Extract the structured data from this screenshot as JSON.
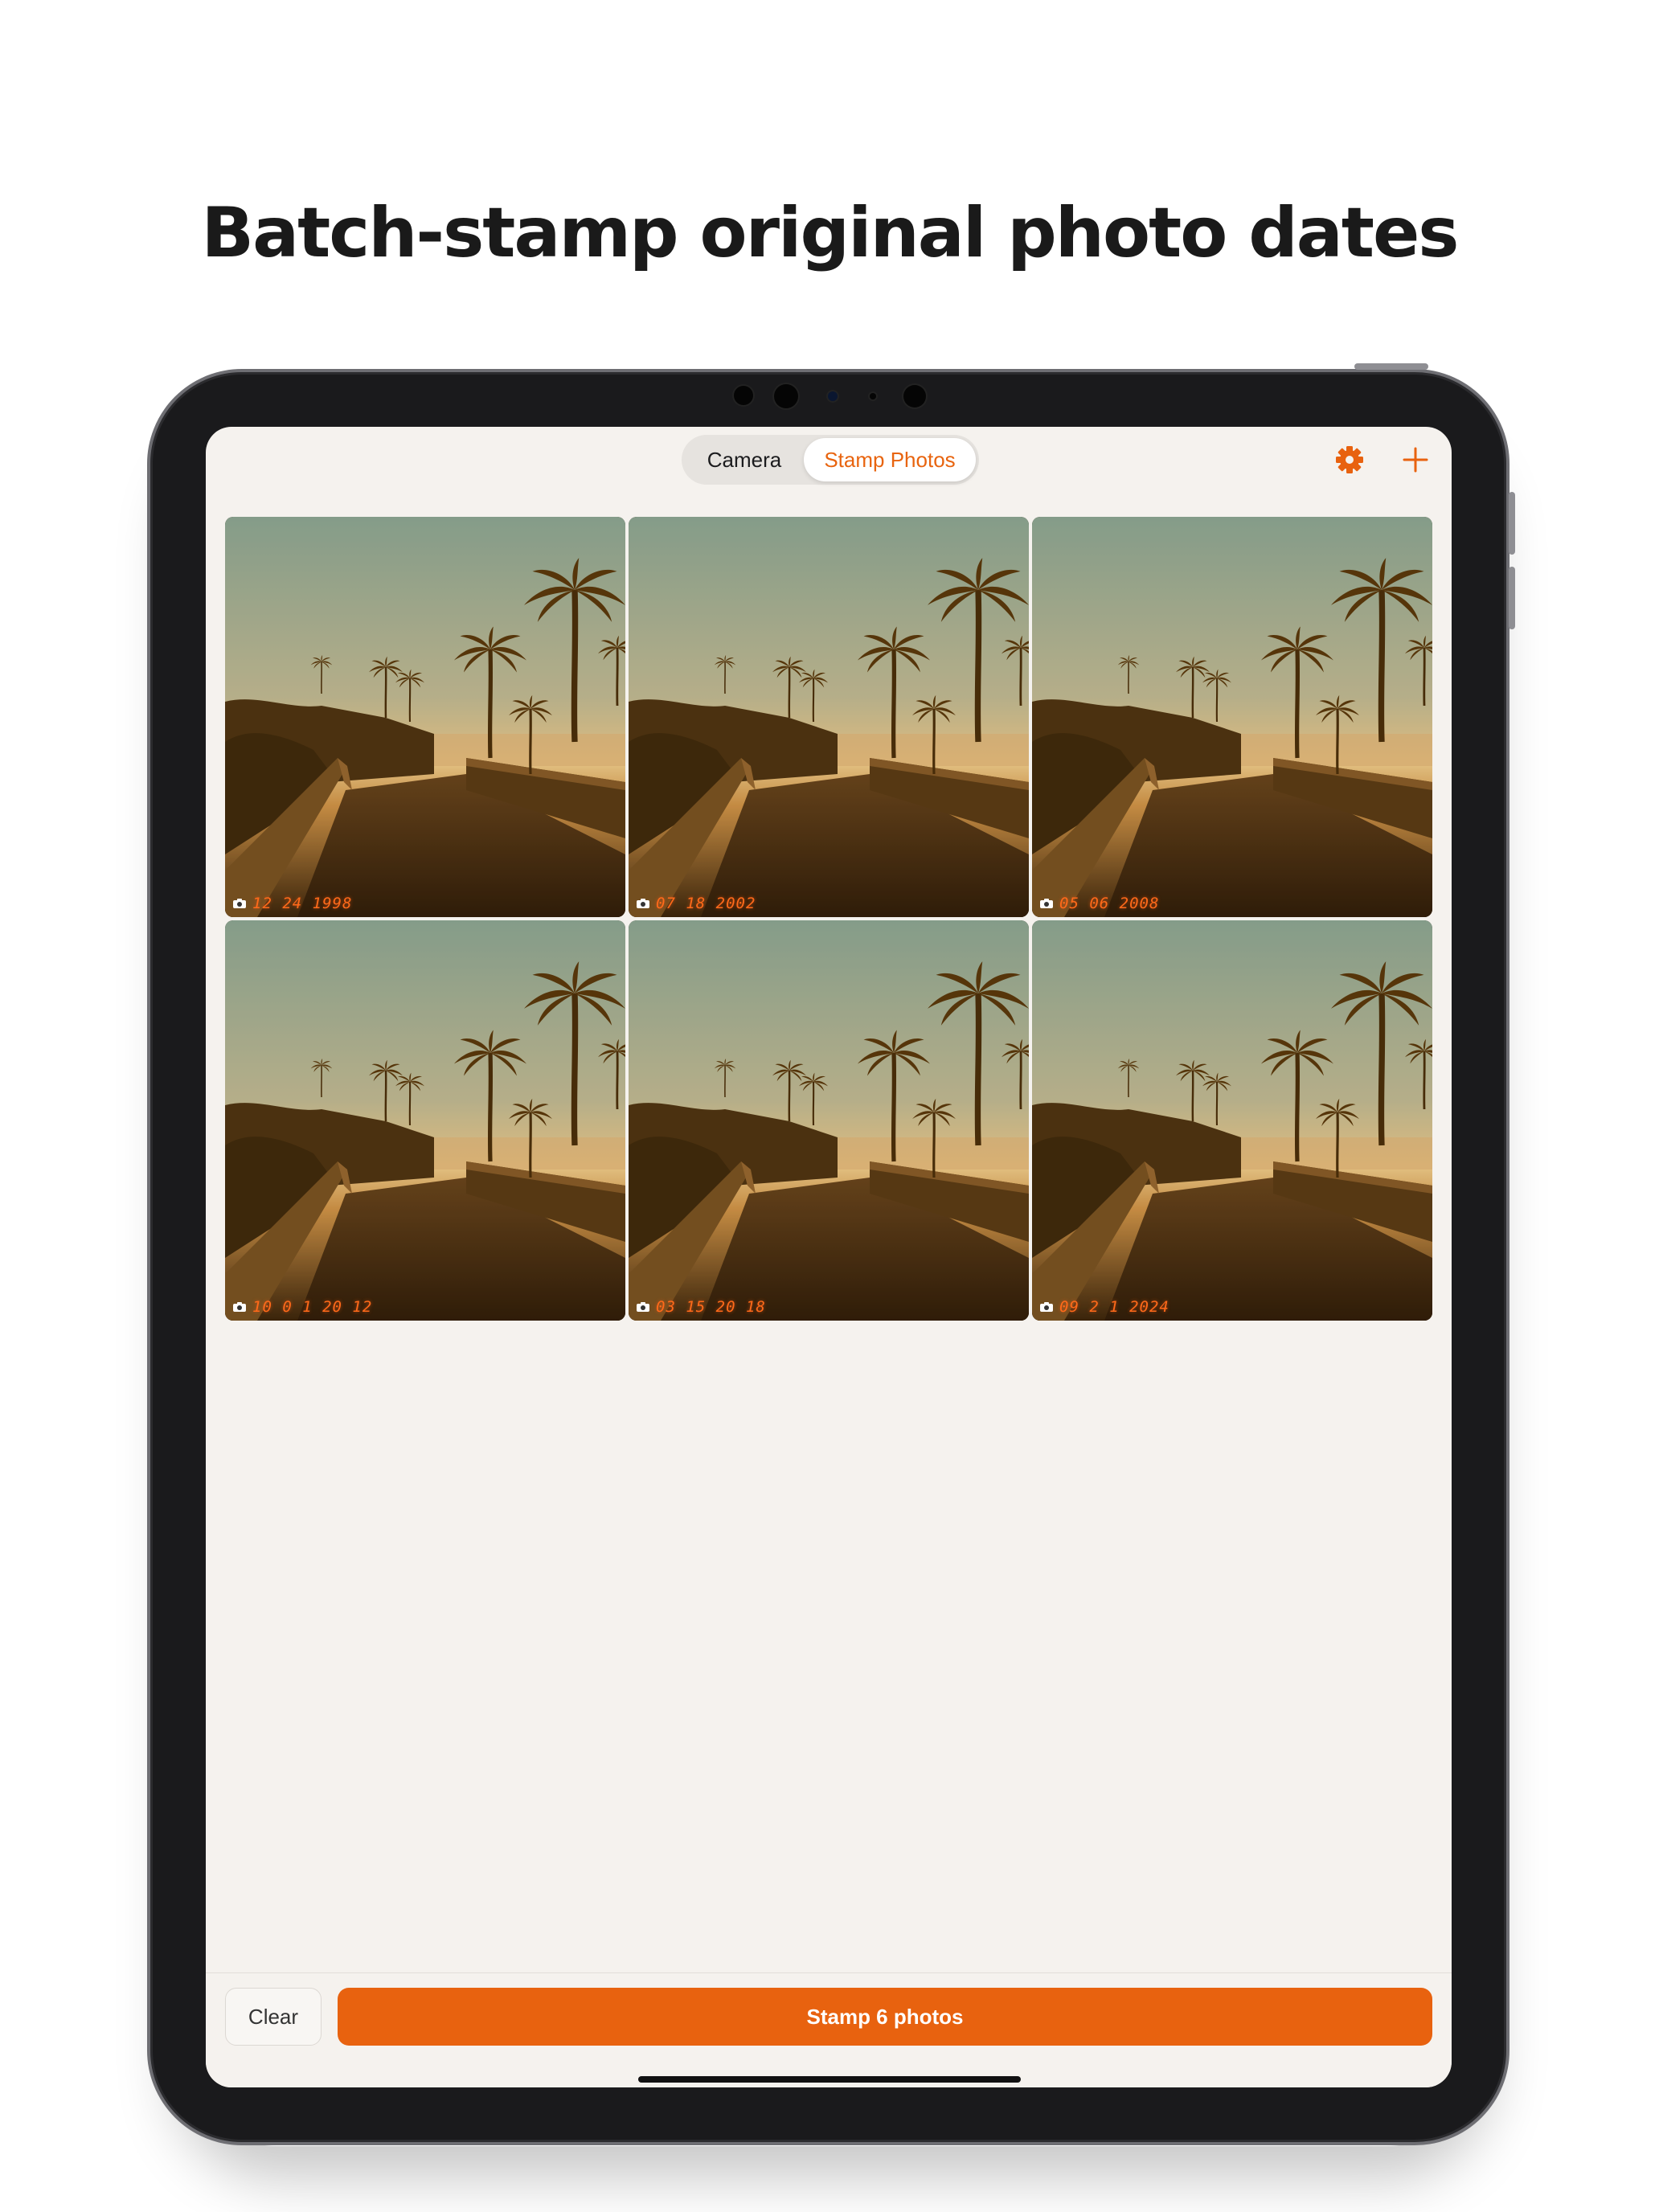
{
  "headline": "Batch-stamp original photo dates",
  "toolbar": {
    "segments": [
      {
        "label": "Camera",
        "active": false
      },
      {
        "label": "Stamp Photos",
        "active": true
      }
    ],
    "settings_icon": "gear-icon",
    "add_icon": "plus-icon"
  },
  "photos": [
    {
      "date": "12 24 1998"
    },
    {
      "date": "07 18 2002"
    },
    {
      "date": "05 06 2008"
    },
    {
      "date": "10 0 1 20 12"
    },
    {
      "date": "03 15 20 18"
    },
    {
      "date": "09 2 1 2024"
    }
  ],
  "actions": {
    "clear_label": "Clear",
    "stamp_label": "Stamp 6 photos"
  },
  "colors": {
    "accent": "#e8620f",
    "screen_background": "#f5f2ee",
    "stamp_text": "#ff6a1a"
  }
}
